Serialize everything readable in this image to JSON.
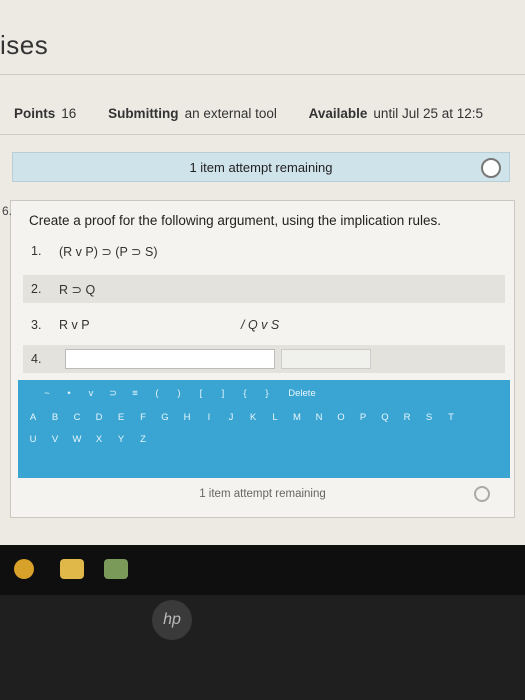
{
  "page": {
    "title": "ises"
  },
  "meta": {
    "points_label": "Points",
    "points_value": "16",
    "submitting_label": "Submitting",
    "submitting_value": "an external tool",
    "available_label": "Available",
    "available_value": "until Jul 25 at 12:5"
  },
  "attempt_banner": {
    "text": "1 item attempt remaining"
  },
  "question": {
    "number": "6.",
    "prompt": "Create a proof for the following argument, using the implication rules.",
    "lines": [
      {
        "n": "1.",
        "text": "(R v P) ⊃ (P ⊃ S)"
      },
      {
        "n": "2.",
        "text": "R ⊃ Q"
      },
      {
        "n": "3.",
        "text": "R v P",
        "justification": "/ Q v S"
      },
      {
        "n": "4.",
        "text": ""
      }
    ]
  },
  "keyboard": {
    "row1": [
      "~",
      "•",
      "v",
      "⊃",
      "≡",
      "(",
      ")",
      "[",
      "]",
      "{",
      "}",
      "Delete"
    ],
    "row2": [
      "A",
      "B",
      "C",
      "D",
      "E",
      "F",
      "G",
      "H",
      "I",
      "J",
      "K",
      "L",
      "M",
      "N",
      "O",
      "P",
      "Q",
      "R",
      "S",
      "T"
    ],
    "row3": [
      "U",
      "V",
      "W",
      "X",
      "Y",
      "Z"
    ]
  },
  "footer": {
    "status": "1 item attempt remaining"
  },
  "bezel": {
    "logo": "hp"
  }
}
